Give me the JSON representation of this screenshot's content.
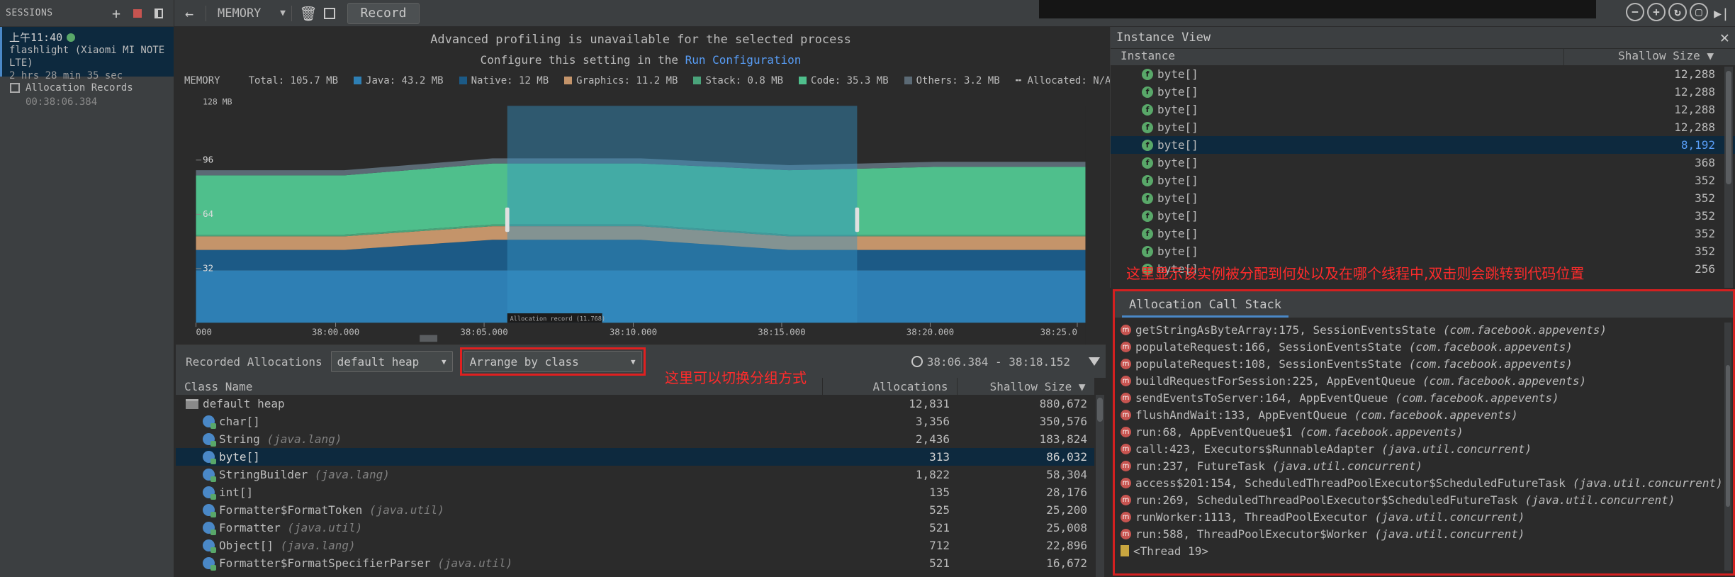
{
  "sessions": {
    "title": "SESSIONS",
    "item": {
      "time": "上午11:40",
      "device": "flashlight (Xiaomi MI NOTE LTE)",
      "duration": "2 hrs 28 min 35 sec"
    },
    "record": {
      "label": "Allocation Records",
      "time": "00:38:06.384"
    }
  },
  "toolbar": {
    "profiler": "MEMORY",
    "record_label": "Record"
  },
  "timeline": {
    "msg_line1": "Advanced profiling is unavailable for the selected process",
    "msg_line2_prefix": "Configure this setting in the ",
    "msg_line2_link": "Run Configuration",
    "memory_label": "MEMORY",
    "y_top_label": "128 MB",
    "y_ticks": [
      "96",
      "64",
      "32"
    ],
    "x_ticks": [
      "000",
      "38:00.000",
      "38:05.000",
      "38:10.000",
      "38:15.000",
      "38:20.000",
      "38:25.0"
    ],
    "record_tag": "Allocation record (11.768)",
    "legend": [
      {
        "label": "Total: 105.7 MB",
        "color": ""
      },
      {
        "label": "Java: 43.2 MB",
        "color": "#2e7fb4"
      },
      {
        "label": "Native: 12 MB",
        "color": "#1c5a86"
      },
      {
        "label": "Graphics: 11.2 MB",
        "color": "#c4946a"
      },
      {
        "label": "Stack: 0.8 MB",
        "color": "#4aa37a"
      },
      {
        "label": "Code: 35.3 MB",
        "color": "#4fbf8c"
      },
      {
        "label": "Others: 3.2 MB",
        "color": "#5b6a75"
      },
      {
        "label": "Allocated: N/A",
        "color": ""
      }
    ]
  },
  "chart_data": {
    "type": "area",
    "x_range_s": [
      0,
      30
    ],
    "ylim": [
      0,
      128
    ],
    "series": [
      {
        "name": "Java",
        "color": "#2e7fb4",
        "values": [
          31,
          31,
          31,
          31,
          31,
          31,
          31
        ]
      },
      {
        "name": "Native",
        "color": "#1c5a86",
        "values": [
          12,
          12,
          18,
          18,
          12,
          12,
          12
        ]
      },
      {
        "name": "Graphics",
        "color": "#c4946a",
        "values": [
          8,
          8,
          8,
          8,
          8,
          8,
          8
        ]
      },
      {
        "name": "Stack",
        "color": "#4aa37a",
        "values": [
          1,
          1,
          1,
          1,
          1,
          1,
          1
        ]
      },
      {
        "name": "Code",
        "color": "#4fbf8c",
        "values": [
          35,
          35,
          36,
          36,
          38,
          40,
          40
        ]
      },
      {
        "name": "Others",
        "color": "#5b6a75",
        "values": [
          3,
          3,
          3,
          3,
          3,
          3,
          3
        ]
      }
    ],
    "selection_s": [
      10.5,
      22.3
    ]
  },
  "alloc": {
    "recorded_label": "Recorded Allocations",
    "heap_select": "default heap",
    "arrange_select": "Arrange by class",
    "annotation": "这里可以切换分组方式",
    "range": "38:06.384 - 38:18.152",
    "columns": [
      "Class Name",
      "Allocations",
      "Shallow Size"
    ],
    "rows": [
      {
        "name": "default heap",
        "pkg": "",
        "alloc": "12,831",
        "size": "880,672",
        "folder": true
      },
      {
        "name": "char[]",
        "pkg": "",
        "alloc": "3,356",
        "size": "350,576"
      },
      {
        "name": "String",
        "pkg": "(java.lang)",
        "alloc": "2,436",
        "size": "183,824"
      },
      {
        "name": "byte[]",
        "pkg": "",
        "alloc": "313",
        "size": "86,032",
        "selected": true
      },
      {
        "name": "StringBuilder",
        "pkg": "(java.lang)",
        "alloc": "1,822",
        "size": "58,304"
      },
      {
        "name": "int[]",
        "pkg": "",
        "alloc": "135",
        "size": "28,176"
      },
      {
        "name": "Formatter$FormatToken",
        "pkg": "(java.util)",
        "alloc": "525",
        "size": "25,200"
      },
      {
        "name": "Formatter",
        "pkg": "(java.util)",
        "alloc": "521",
        "size": "25,008"
      },
      {
        "name": "Object[]",
        "pkg": "(java.lang)",
        "alloc": "712",
        "size": "22,896"
      },
      {
        "name": "Formatter$FormatSpecifierParser",
        "pkg": "(java.util)",
        "alloc": "521",
        "size": "16,672"
      }
    ]
  },
  "instance": {
    "title": "Instance View",
    "columns": [
      "Instance",
      "Shallow Size"
    ],
    "rows": [
      {
        "name": "byte[]",
        "size": "12,288"
      },
      {
        "name": "byte[]",
        "size": "12,288"
      },
      {
        "name": "byte[]",
        "size": "12,288"
      },
      {
        "name": "byte[]",
        "size": "12,288"
      },
      {
        "name": "byte[]",
        "size": "8,192",
        "selected": true
      },
      {
        "name": "byte[]",
        "size": "368"
      },
      {
        "name": "byte[]",
        "size": "352"
      },
      {
        "name": "byte[]",
        "size": "352"
      },
      {
        "name": "byte[]",
        "size": "352"
      },
      {
        "name": "byte[]",
        "size": "352"
      },
      {
        "name": "byte[]",
        "size": "352"
      },
      {
        "name": "byte[]",
        "size": "256"
      }
    ],
    "annotation": "这里显示该实例被分配到何处以及在哪个线程中,双击则会跳转到代码位置"
  },
  "stack": {
    "tab": "Allocation Call Stack",
    "frames": [
      {
        "method": "getStringAsByteArray:175, SessionEventsState",
        "pkg": "(com.facebook.appevents)"
      },
      {
        "method": "populateRequest:166, SessionEventsState",
        "pkg": "(com.facebook.appevents)"
      },
      {
        "method": "populateRequest:108, SessionEventsState",
        "pkg": "(com.facebook.appevents)"
      },
      {
        "method": "buildRequestForSession:225, AppEventQueue",
        "pkg": "(com.facebook.appevents)"
      },
      {
        "method": "sendEventsToServer:164, AppEventQueue",
        "pkg": "(com.facebook.appevents)"
      },
      {
        "method": "flushAndWait:133, AppEventQueue",
        "pkg": "(com.facebook.appevents)"
      },
      {
        "method": "run:68, AppEventQueue$1",
        "pkg": "(com.facebook.appevents)"
      },
      {
        "method": "call:423, Executors$RunnableAdapter",
        "pkg": "(java.util.concurrent)"
      },
      {
        "method": "run:237, FutureTask",
        "pkg": "(java.util.concurrent)"
      },
      {
        "method": "access$201:154, ScheduledThreadPoolExecutor$ScheduledFutureTask",
        "pkg": "(java.util.concurrent)"
      },
      {
        "method": "run:269, ScheduledThreadPoolExecutor$ScheduledFutureTask",
        "pkg": "(java.util.concurrent)"
      },
      {
        "method": "runWorker:1113, ThreadPoolExecutor",
        "pkg": "(java.util.concurrent)"
      },
      {
        "method": "run:588, ThreadPoolExecutor$Worker",
        "pkg": "(java.util.concurrent)"
      }
    ],
    "thread": "<Thread 19>"
  }
}
